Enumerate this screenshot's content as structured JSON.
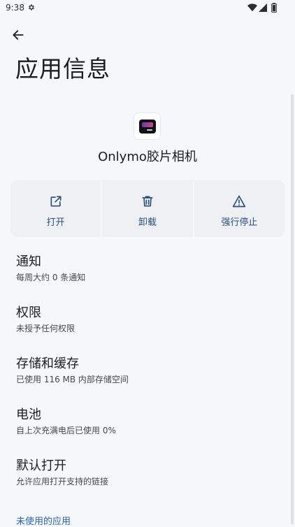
{
  "status": {
    "time": "9:38"
  },
  "header": {
    "title": "应用信息"
  },
  "app": {
    "name": "Onlymo胶片相机"
  },
  "actions": [
    {
      "label": "打开",
      "icon": "open-in-new-icon"
    },
    {
      "label": "卸载",
      "icon": "trash-icon"
    },
    {
      "label": "强行停止",
      "icon": "warning-icon"
    }
  ],
  "settings": [
    {
      "title": "通知",
      "subtitle": "每周大约 0 条通知"
    },
    {
      "title": "权限",
      "subtitle": "未授予任何权限"
    },
    {
      "title": "存储和缓存",
      "subtitle": "已使用 116 MB 内部存储空间"
    },
    {
      "title": "电池",
      "subtitle": "自上次充满电后已使用 0%"
    },
    {
      "title": "默认打开",
      "subtitle": "允许应用打开支持的链接"
    }
  ],
  "section": {
    "unused_apps": "未使用的应用"
  },
  "colors": {
    "accent": "#2a4e7e",
    "link": "#2a62b6",
    "background": "#f6f7fb"
  }
}
